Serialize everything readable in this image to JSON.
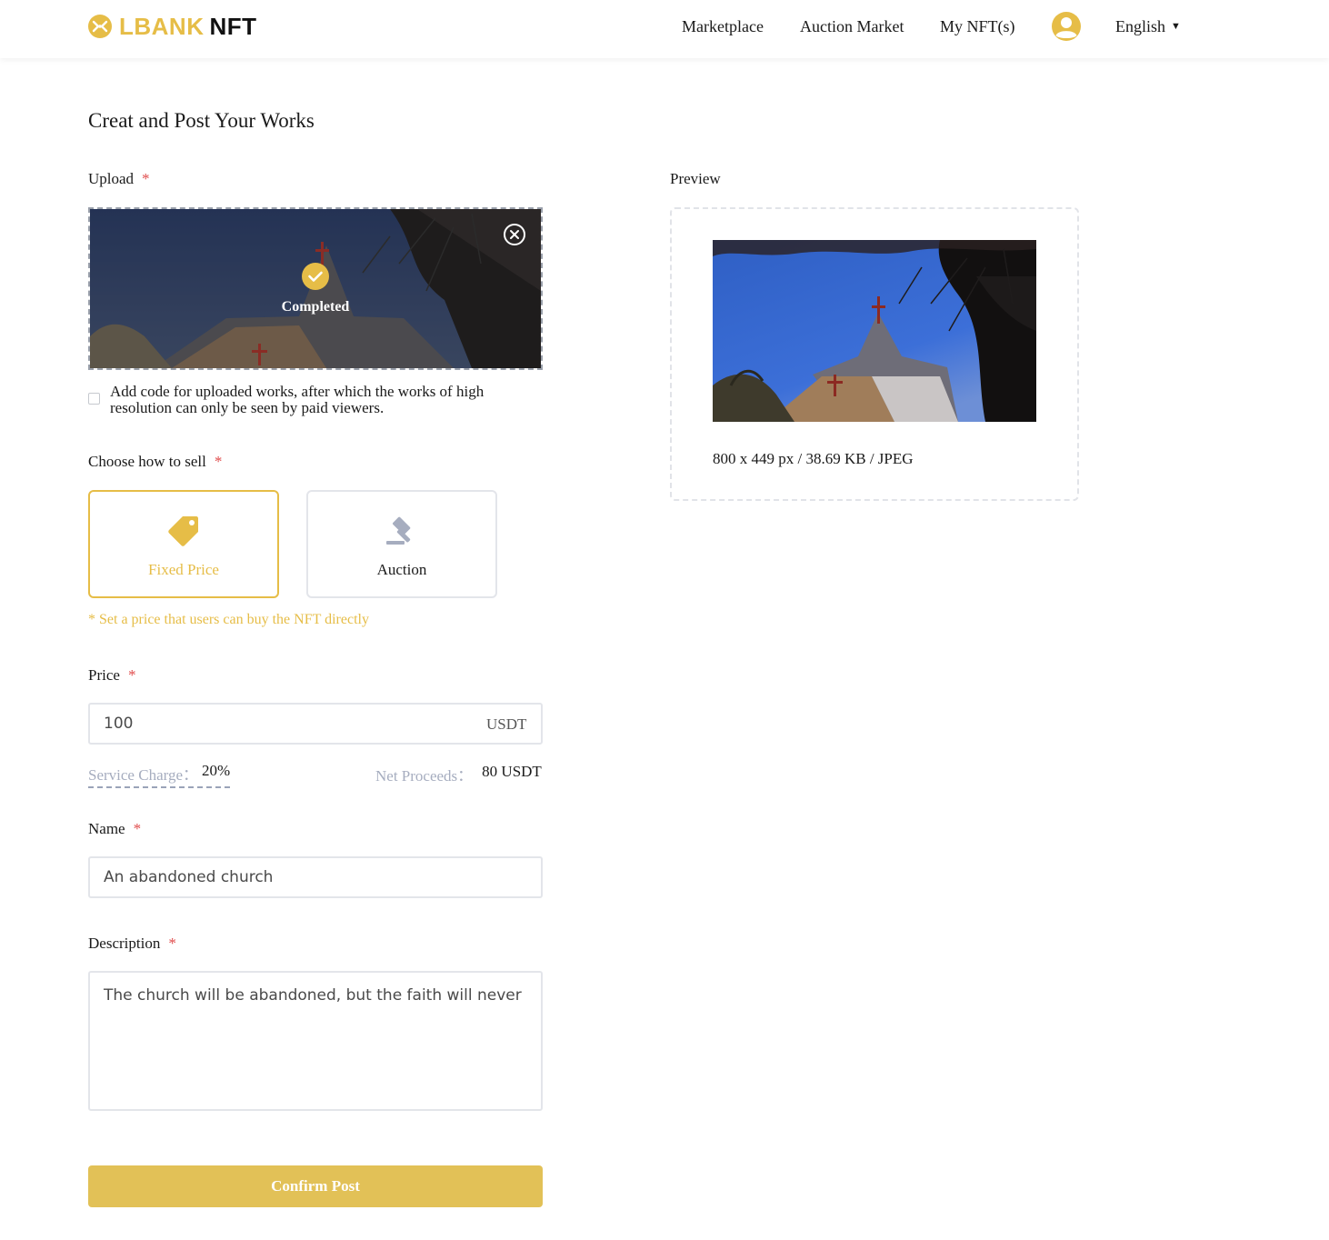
{
  "brand": {
    "name": "LBANK",
    "suffix": "NFT",
    "accent": "#e6bd47"
  },
  "nav": {
    "marketplace": "Marketplace",
    "auction_market": "Auction Market",
    "my_nfts": "My NFT(s)",
    "language": "English"
  },
  "page": {
    "title": "Creat and Post Your Works"
  },
  "upload": {
    "label": "Upload",
    "required": "*",
    "status": "Completed",
    "watermark_option": "Add code for uploaded works, after which the works of high resolution can only be seen by paid viewers."
  },
  "sell": {
    "label": "Choose how to sell",
    "required": "*",
    "fixed_label": "Fixed Price",
    "auction_label": "Auction",
    "selected": "Fixed Price",
    "hint": "* Set a price that users can buy the NFT directly"
  },
  "price": {
    "label": "Price",
    "required": "*",
    "value": "100",
    "currency": "USDT",
    "service_label": "Service Charge：",
    "service_value": "20%",
    "net_label": "Net Proceeds：",
    "net_value": "80 USDT"
  },
  "name_field": {
    "label": "Name",
    "required": "*",
    "value": "An abandoned church"
  },
  "description": {
    "label": "Description",
    "required": "*",
    "value": "The church will be abandoned, but the faith will never"
  },
  "confirm_label": "Confirm Post",
  "preview": {
    "label": "Preview",
    "meta": "800 x 449 px / 38.69 KB / JPEG"
  }
}
